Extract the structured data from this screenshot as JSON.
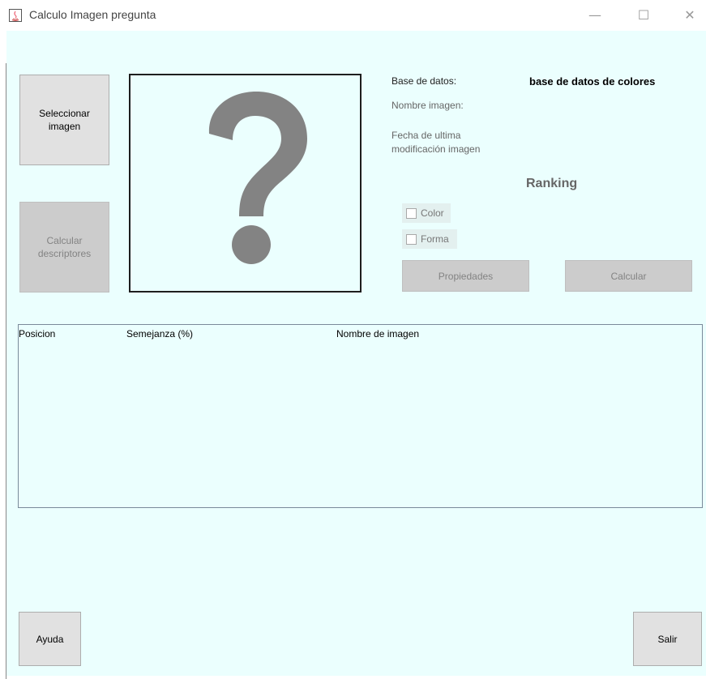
{
  "window": {
    "title": "Calculo Imagen pregunta",
    "controls": {
      "minimize": "—",
      "maximize": "☐",
      "close": "✕"
    }
  },
  "buttons": {
    "select_image": "Seleccionar imagen",
    "compute_descriptors": "Calcular descriptores",
    "properties": "Propiedades",
    "calculate": "Calcular",
    "help": "Ayuda",
    "exit": "Salir"
  },
  "info": {
    "database_label": "Base de datos:",
    "database_value": "base de datos de colores",
    "image_name_label": "Nombre imagen:",
    "modified_label_line1": "Fecha de ultima",
    "modified_label_line2": "modificación imagen"
  },
  "ranking": {
    "title": "Ranking",
    "options": [
      {
        "label": "Color",
        "checked": false
      },
      {
        "label": "Forma",
        "checked": false
      }
    ]
  },
  "table": {
    "columns": [
      "Posicion",
      "Semejanza (%)",
      "Nombre de imagen"
    ],
    "rows": []
  },
  "placeholder": {
    "icon": "question-mark-icon",
    "color": "#838383"
  }
}
